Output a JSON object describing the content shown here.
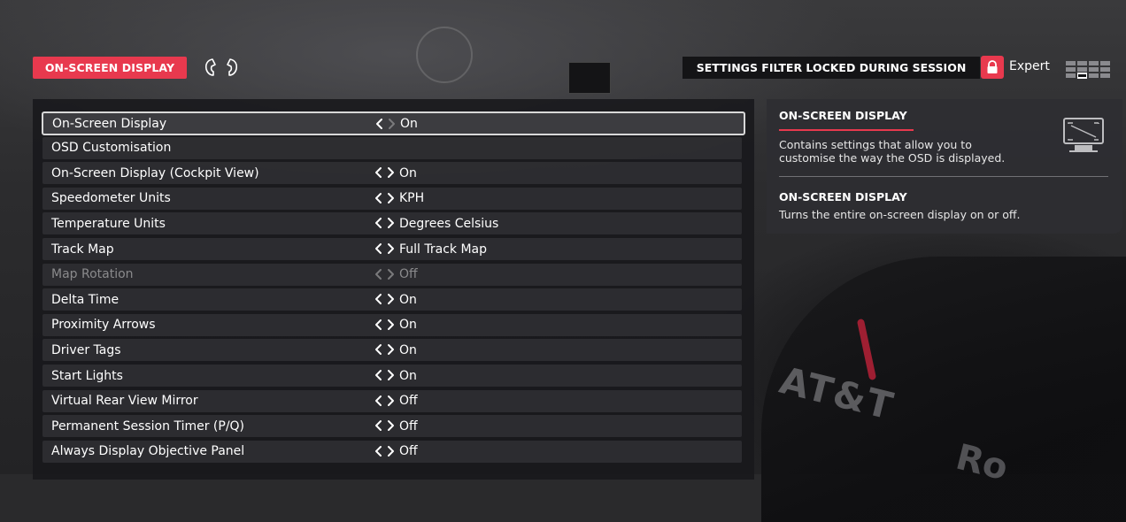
{
  "header": {
    "page_tag": "ON-SCREEN DISPLAY",
    "bumper_left_icon": "left-bumper-icon",
    "bumper_right_icon": "right-bumper-icon",
    "filter_notice": "SETTINGS FILTER LOCKED DURING SESSION",
    "lock_icon": "lock-icon",
    "difficulty_label": "Expert",
    "grid_icon": "settings-grid-icon"
  },
  "colors": {
    "accent": "#e8394e",
    "panel": "#18181b",
    "row": "#323236",
    "disabled_text": "#8a8a8c"
  },
  "settings": [
    {
      "label": "On-Screen Display",
      "value": "On",
      "selected": true,
      "disabled": false,
      "has_value": true
    },
    {
      "label": "OSD Customisation",
      "value": "",
      "selected": false,
      "disabled": false,
      "has_value": false
    },
    {
      "label": "On-Screen Display (Cockpit View)",
      "value": "On",
      "selected": false,
      "disabled": false,
      "has_value": true
    },
    {
      "label": "Speedometer Units",
      "value": "KPH",
      "selected": false,
      "disabled": false,
      "has_value": true
    },
    {
      "label": "Temperature Units",
      "value": "Degrees Celsius",
      "selected": false,
      "disabled": false,
      "has_value": true
    },
    {
      "label": "Track Map",
      "value": "Full Track Map",
      "selected": false,
      "disabled": false,
      "has_value": true
    },
    {
      "label": "Map Rotation",
      "value": "Off",
      "selected": false,
      "disabled": true,
      "has_value": true
    },
    {
      "label": "Delta Time",
      "value": "On",
      "selected": false,
      "disabled": false,
      "has_value": true
    },
    {
      "label": "Proximity Arrows",
      "value": "On",
      "selected": false,
      "disabled": false,
      "has_value": true
    },
    {
      "label": "Driver Tags",
      "value": "On",
      "selected": false,
      "disabled": false,
      "has_value": true
    },
    {
      "label": "Start Lights",
      "value": "On",
      "selected": false,
      "disabled": false,
      "has_value": true
    },
    {
      "label": "Virtual Rear View Mirror",
      "value": "Off",
      "selected": false,
      "disabled": false,
      "has_value": true
    },
    {
      "label": "Permanent Session Timer (P/Q)",
      "value": "Off",
      "selected": false,
      "disabled": false,
      "has_value": true
    },
    {
      "label": "Always Display Objective Panel",
      "value": "Off",
      "selected": false,
      "disabled": false,
      "has_value": true
    }
  ],
  "info": {
    "section_title": "ON-SCREEN DISPLAY",
    "section_text_line1": "Contains settings that allow you to",
    "section_text_line2": "customise the way the OSD is displayed.",
    "item_title": "ON-SCREEN DISPLAY",
    "item_text": "Turns the entire on-screen display on or off.",
    "icon": "monitor-icon"
  },
  "background": {
    "car_livery_text": "AT&T",
    "car_livery_text2": "Ro"
  }
}
